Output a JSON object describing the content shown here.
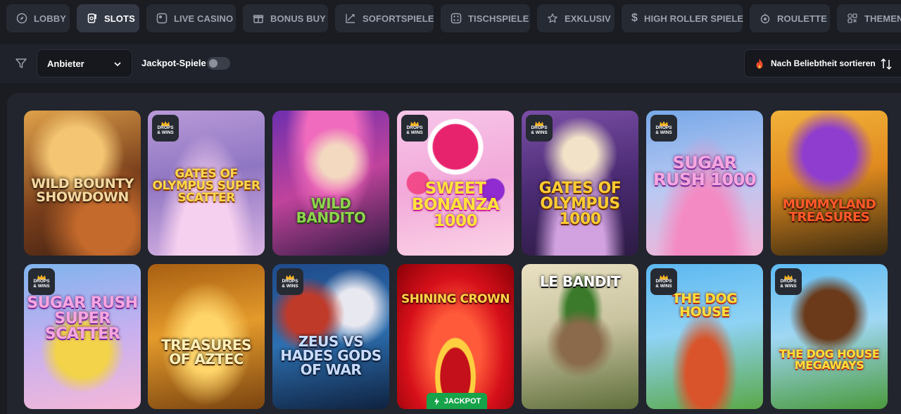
{
  "categories": [
    {
      "label": "LOBBY",
      "icon": "compass-icon",
      "active": false
    },
    {
      "label": "SLOTS",
      "icon": "slot-machine-icon",
      "active": true
    },
    {
      "label": "LIVE CASINO",
      "icon": "live-icon",
      "active": false
    },
    {
      "label": "BONUS BUY",
      "icon": "gift-icon",
      "active": false
    },
    {
      "label": "SOFORTSPIELE",
      "icon": "chart-arrow-icon",
      "active": false
    },
    {
      "label": "TISCHSPIELE",
      "icon": "dice-icon",
      "active": false
    },
    {
      "label": "EXKLUSIV",
      "icon": "star-icon",
      "active": false
    },
    {
      "label": "HIGH ROLLER SPIELE",
      "icon": "dollar-icon",
      "active": false
    },
    {
      "label": "ROULETTE",
      "icon": "roulette-icon",
      "active": false
    },
    {
      "label": "THEMEN",
      "icon": "themes-icon",
      "active": false
    }
  ],
  "filters": {
    "provider_label": "Anbieter",
    "jackpot_label": "Jackpot-Spiele",
    "jackpot_enabled": false,
    "sort_label": "Nach Beliebtheit sortieren"
  },
  "badges": {
    "drops_wins_line1": "DROPS",
    "drops_wins_line2": "& WINS",
    "jackpot": "JACKPOT"
  },
  "games": [
    {
      "title": "WILD BOUNTY SHOWDOWN",
      "drops_wins": false
    },
    {
      "title": "GATES OF OLYMPUS SUPER SCATTER",
      "drops_wins": true
    },
    {
      "title": "WILD BANDITO",
      "drops_wins": false
    },
    {
      "title": "SWEET BONANZA 1000",
      "drops_wins": true
    },
    {
      "title": "GATES OF OLYMPUS 1000",
      "drops_wins": true
    },
    {
      "title": "SUGAR RUSH 1000",
      "drops_wins": true
    },
    {
      "title": "MUMMYLAND TREASURES",
      "drops_wins": false
    },
    {
      "title": "SUGAR RUSH SUPER SCATTER",
      "drops_wins": true
    },
    {
      "title": "TREASURES OF AZTEC",
      "drops_wins": false
    },
    {
      "title": "ZEUS VS HADES GODS OF WAR",
      "drops_wins": true
    },
    {
      "title": "SHINING CROWN",
      "drops_wins": false,
      "jackpot": true
    },
    {
      "title": "LE BANDIT",
      "drops_wins": false
    },
    {
      "title": "THE DOG HOUSE",
      "drops_wins": true
    },
    {
      "title": "THE DOG HOUSE MEGAWAYS",
      "drops_wins": true
    }
  ],
  "colors": {
    "background": "#1a1c22",
    "chip": "#262a33",
    "chip_active": "#333845",
    "jackpot_green": "#16a34a"
  }
}
